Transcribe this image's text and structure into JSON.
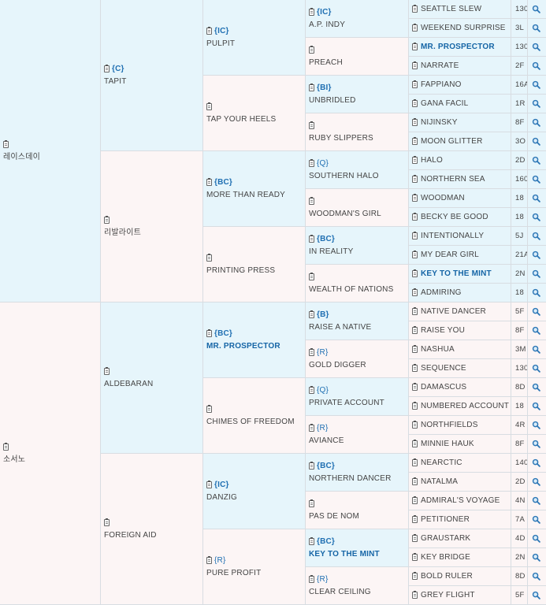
{
  "col1": [
    {
      "name": "레이스데이",
      "tag": ""
    },
    {
      "name": "소서노",
      "tag": ""
    }
  ],
  "col2": [
    {
      "name": "TAPIT",
      "tag": "{C}",
      "hl": false
    },
    {
      "name": "리발라이트",
      "tag": "",
      "hl": false
    },
    {
      "name": "ALDEBARAN",
      "tag": "",
      "hl": false
    },
    {
      "name": "FOREIGN AID",
      "tag": "",
      "hl": false
    }
  ],
  "col3": [
    {
      "name": "PULPIT",
      "tag": "{IC}",
      "hl": false
    },
    {
      "name": "TAP YOUR HEELS",
      "tag": "",
      "hl": false
    },
    {
      "name": "MORE THAN READY",
      "tag": "{BC}",
      "hl": false
    },
    {
      "name": "PRINTING PRESS",
      "tag": "",
      "hl": false
    },
    {
      "name": "MR. PROSPECTOR",
      "tag": "{BC}",
      "hl": true
    },
    {
      "name": "CHIMES OF FREEDOM",
      "tag": "",
      "hl": false
    },
    {
      "name": "DANZIG",
      "tag": "{IC}",
      "hl": false
    },
    {
      "name": "PURE PROFIT",
      "tag": "{R}",
      "hl": false
    }
  ],
  "col4": [
    {
      "name": "A.P. INDY",
      "tag": "{IC}",
      "hl": false
    },
    {
      "name": "PREACH",
      "tag": "",
      "hl": false
    },
    {
      "name": "UNBRIDLED",
      "tag": "{BI}",
      "hl": false
    },
    {
      "name": "RUBY SLIPPERS",
      "tag": "",
      "hl": false
    },
    {
      "name": "SOUTHERN HALO",
      "tag": "{Q}",
      "hl": false
    },
    {
      "name": "WOODMAN'S GIRL",
      "tag": "",
      "hl": false
    },
    {
      "name": "IN REALITY",
      "tag": "{BC}",
      "hl": false
    },
    {
      "name": "WEALTH OF NATIONS",
      "tag": "",
      "hl": false
    },
    {
      "name": "RAISE A NATIVE",
      "tag": "{B}",
      "hl": false
    },
    {
      "name": "GOLD DIGGER",
      "tag": "{R}",
      "hl": false
    },
    {
      "name": "PRIVATE ACCOUNT",
      "tag": "{Q}",
      "hl": false
    },
    {
      "name": "AVIANCE",
      "tag": "{R}",
      "hl": false
    },
    {
      "name": "NORTHERN DANCER",
      "tag": "{BC}",
      "hl": false
    },
    {
      "name": "PAS DE NOM",
      "tag": "",
      "hl": false
    },
    {
      "name": "KEY TO THE MINT",
      "tag": "{BC}",
      "hl": true
    },
    {
      "name": "CLEAR CEILING",
      "tag": "{R}",
      "hl": false
    }
  ],
  "col5": [
    {
      "name": "SEATTLE SLEW",
      "year": "130",
      "hl": false
    },
    {
      "name": "WEEKEND SURPRISE",
      "year": "3L",
      "hl": false
    },
    {
      "name": "MR. PROSPECTOR",
      "year": "130",
      "hl": true
    },
    {
      "name": "NARRATE",
      "year": "2F",
      "hl": false
    },
    {
      "name": "FAPPIANO",
      "year": "16A",
      "hl": false
    },
    {
      "name": "GANA FACIL",
      "year": "1R",
      "hl": false
    },
    {
      "name": "NIJINSKY",
      "year": "8F",
      "hl": false
    },
    {
      "name": "MOON GLITTER",
      "year": "3O",
      "hl": false
    },
    {
      "name": "HALO",
      "year": "2D",
      "hl": false
    },
    {
      "name": "NORTHERN SEA",
      "year": "160",
      "hl": false
    },
    {
      "name": "WOODMAN",
      "year": "18",
      "hl": false
    },
    {
      "name": "BECKY BE GOOD",
      "year": "18",
      "hl": false
    },
    {
      "name": "INTENTIONALLY",
      "year": "5J",
      "hl": false
    },
    {
      "name": "MY DEAR GIRL",
      "year": "21A",
      "hl": false
    },
    {
      "name": "KEY TO THE MINT",
      "year": "2N",
      "hl": true
    },
    {
      "name": "ADMIRING",
      "year": "18",
      "hl": false
    },
    {
      "name": "NATIVE DANCER",
      "year": "5F",
      "hl": false
    },
    {
      "name": "RAISE YOU",
      "year": "8F",
      "hl": false
    },
    {
      "name": "NASHUA",
      "year": "3M",
      "hl": false
    },
    {
      "name": "SEQUENCE",
      "year": "130",
      "hl": false
    },
    {
      "name": "DAMASCUS",
      "year": "8D",
      "hl": false
    },
    {
      "name": "NUMBERED ACCOUNT",
      "year": "18",
      "hl": false
    },
    {
      "name": "NORTHFIELDS",
      "year": "4R",
      "hl": false
    },
    {
      "name": "MINNIE HAUK",
      "year": "8F",
      "hl": false
    },
    {
      "name": "NEARCTIC",
      "year": "140",
      "hl": false
    },
    {
      "name": "NATALMA",
      "year": "2D",
      "hl": false
    },
    {
      "name": "ADMIRAL'S VOYAGE",
      "year": "4N",
      "hl": false
    },
    {
      "name": "PETITIONER",
      "year": "7A",
      "hl": false
    },
    {
      "name": "GRAUSTARK",
      "year": "4D",
      "hl": false
    },
    {
      "name": "KEY BRIDGE",
      "year": "2N",
      "hl": false
    },
    {
      "name": "BOLD RULER",
      "year": "8D",
      "hl": false
    },
    {
      "name": "GREY FLIGHT",
      "year": "5F",
      "hl": false
    }
  ],
  "icons": {
    "detail": "clipboard-icon",
    "search": "magnifier-icon"
  },
  "colors": {
    "sire_bg": "#e6f5fb",
    "dam_bg": "#fcf5f5",
    "highlight": "#1565a6",
    "tag": "#1f6fb2"
  }
}
